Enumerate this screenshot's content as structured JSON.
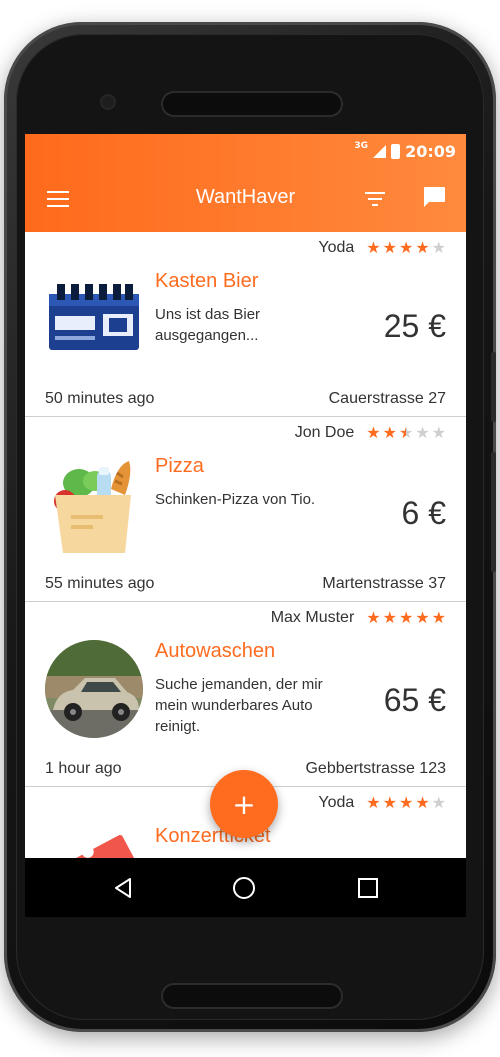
{
  "status_bar": {
    "network": "3G",
    "time": "20:09"
  },
  "app": {
    "title": "WantHaver"
  },
  "toolbar_icons": [
    "menu-icon",
    "filter-icon",
    "chat-icon"
  ],
  "accent_color": "#ff6b1f",
  "listings": [
    {
      "user": "Yoda",
      "rating": 4,
      "max_rating": 5,
      "title": "Kasten Bier",
      "description": "Uns ist das Bier ausgegangen...",
      "price": "25 €",
      "time": "50 minutes ago",
      "address": "Cauerstrasse 27",
      "image": "beer-crate-image"
    },
    {
      "user": "Jon Doe",
      "rating": 2.5,
      "max_rating": 5,
      "title": "Pizza",
      "description": "Schinken-Pizza von Tio.",
      "price": "6 €",
      "time": "55 minutes ago",
      "address": "Martenstrasse 37",
      "image": "grocery-bag-icon"
    },
    {
      "user": "Max Muster",
      "rating": 5,
      "max_rating": 5,
      "title": "Autowaschen",
      "description": "Suche jemanden, der mir mein wunderbares Auto reinigt.",
      "price": "65 €",
      "time": "1 hour ago",
      "address": "Gebbertstrasse 123",
      "image": "dirty-car-photo"
    },
    {
      "user": "Yoda",
      "rating": 4,
      "max_rating": 5,
      "title": "Konzertticket",
      "image": "ticket-icon"
    }
  ],
  "fab": {
    "label": "+"
  },
  "navbar": [
    "back-icon",
    "home-icon",
    "recents-icon"
  ]
}
